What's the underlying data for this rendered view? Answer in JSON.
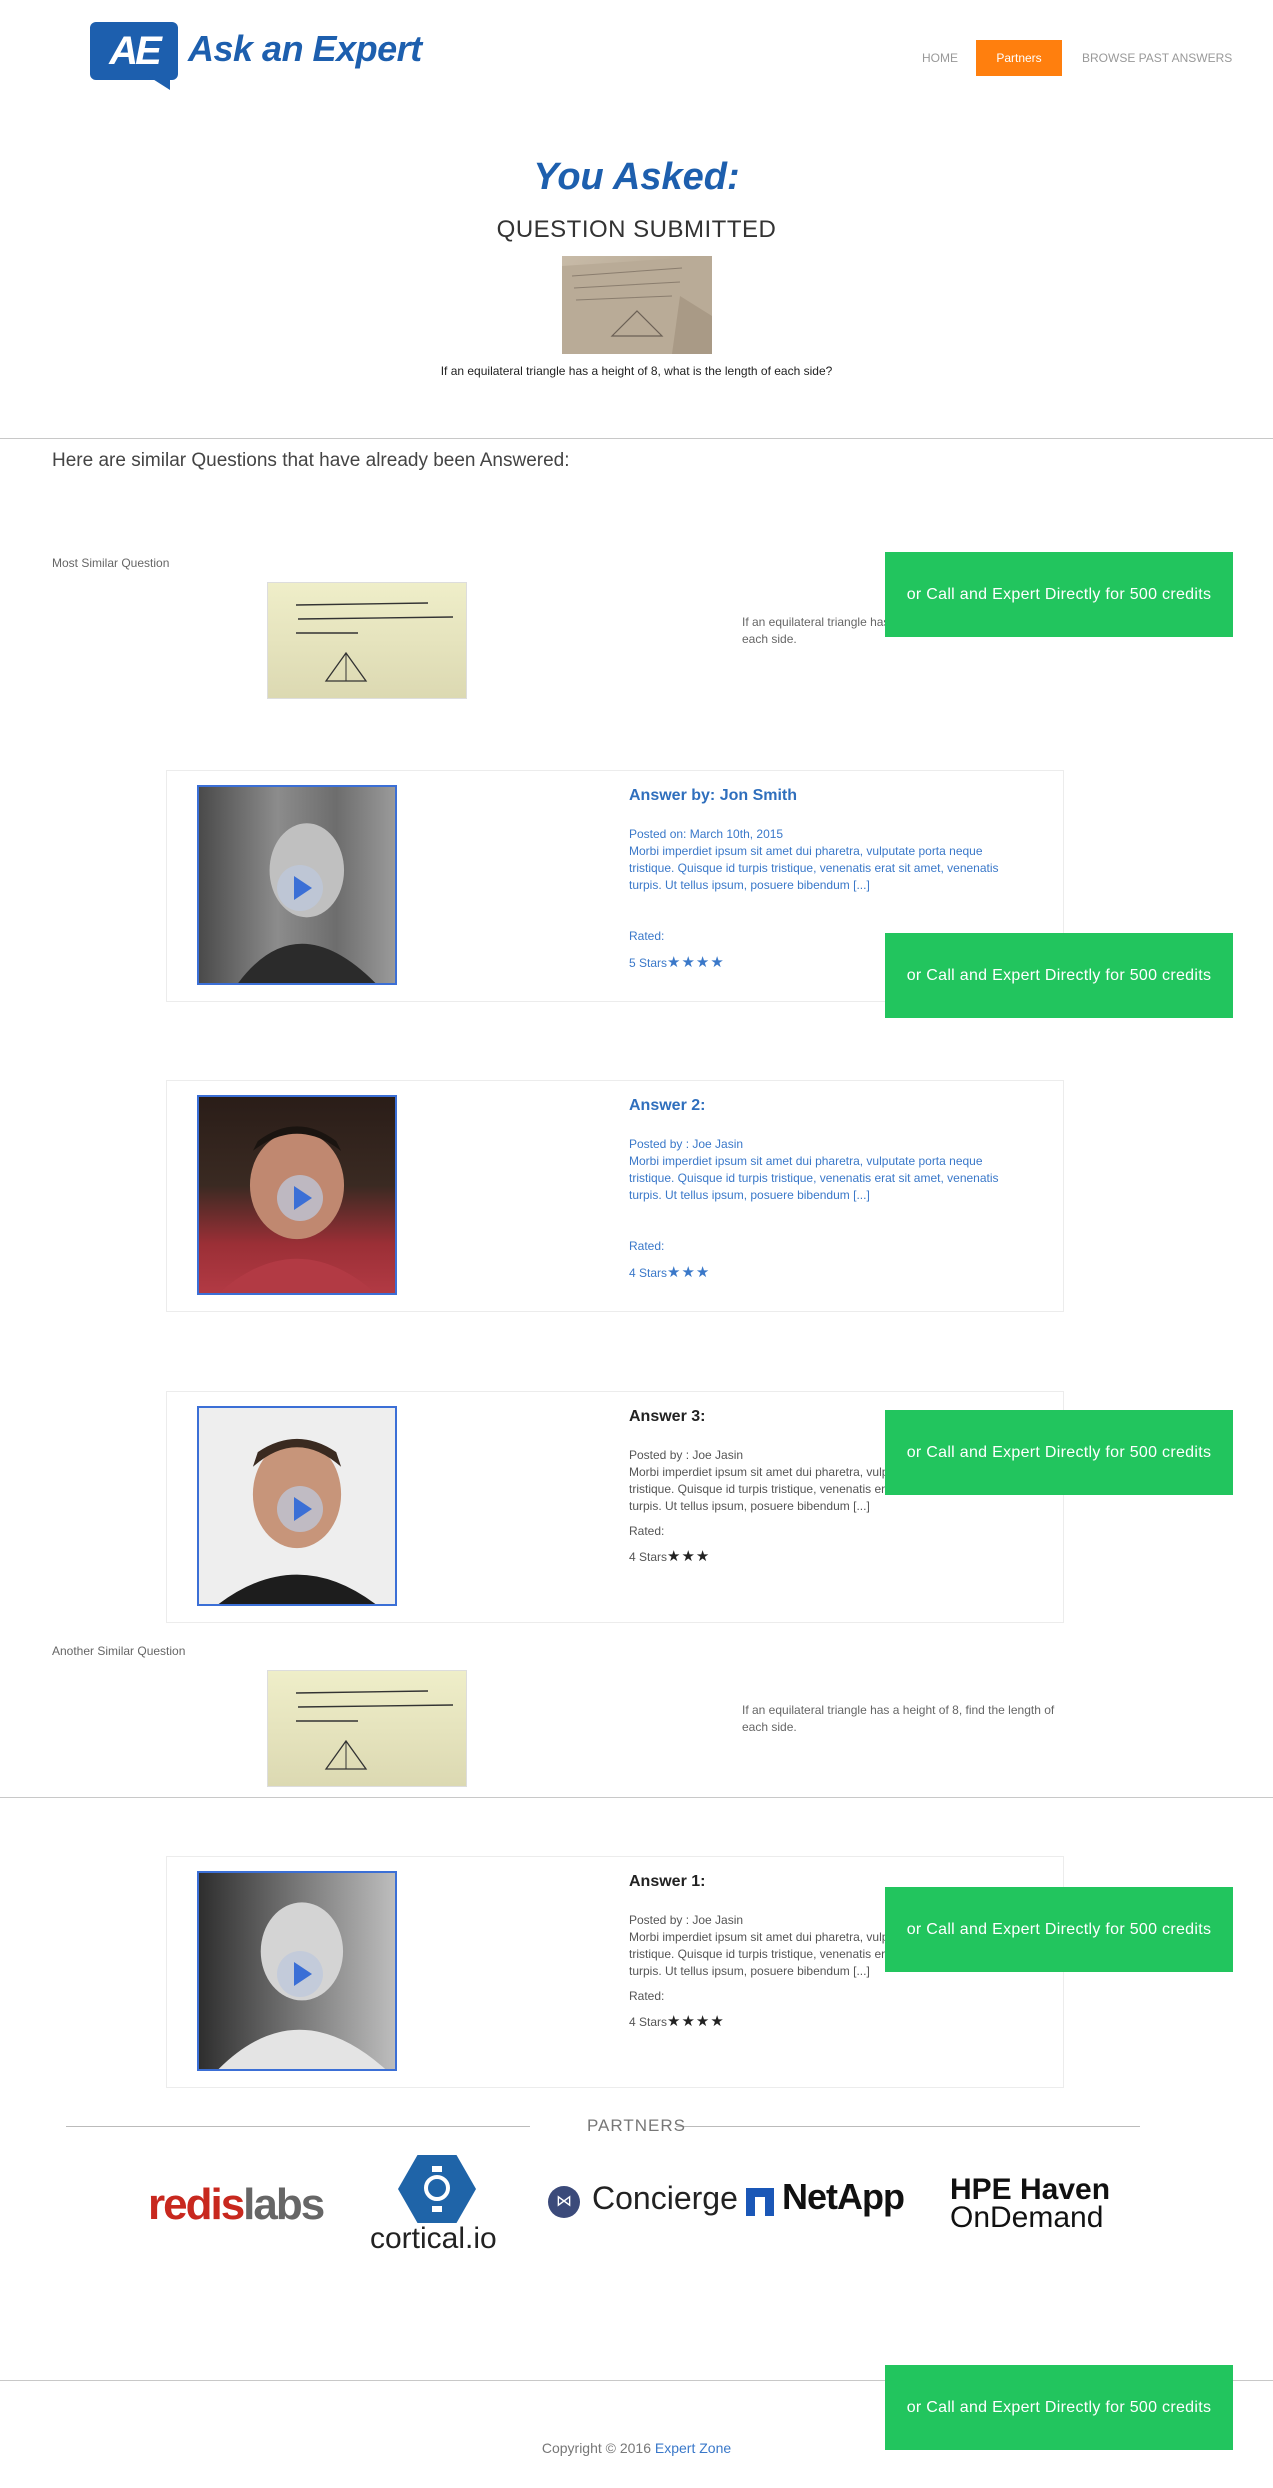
{
  "header": {
    "logo_badge": "AE",
    "logo_text": "Ask an Expert",
    "nav": {
      "home": "HOME",
      "partners": "Partners",
      "browse": "BROWSE PAST ANSWERS"
    }
  },
  "asked": {
    "heading": "You Asked:",
    "status": "QUESTION SUBMITTED",
    "question": "If an equilateral triangle has a height of 8, what is the length of each side?"
  },
  "similar": {
    "heading": "Here are similar Questions that have already been Answered:",
    "most_label": "Most Similar Question",
    "most_text": "If an equilateral triangle has a height of 8, find the length of each side.",
    "another_label": "Another Similar Question",
    "another_text": "If an equilateral triangle has a height of 8, find the length of each side."
  },
  "cta_label": "or Call and Expert Directly for 500 credits",
  "answers": [
    {
      "title": "Answer by: Jon Smith",
      "posted": "Posted on: March 10th, 2015",
      "body": "Morbi imperdiet ipsum sit amet dui pharetra, vulputate porta neque tristique. Quisque id turpis tristique, venenatis erat sit amet, venenatis turpis. Ut tellus ipsum, posuere bibendum [...]",
      "rated_label": "Rated:",
      "stars_text": "5 Stars",
      "stars": "★★★★"
    },
    {
      "title": "Answer 2:",
      "posted": "Posted by : Joe Jasin",
      "body": "Morbi imperdiet ipsum sit amet dui pharetra, vulputate porta neque tristique. Quisque id turpis tristique, venenatis erat sit amet, venenatis turpis. Ut tellus ipsum, posuere bibendum [...]",
      "rated_label": "Rated:",
      "stars_text": "4 Stars",
      "stars": "★★★"
    },
    {
      "title": "Answer 3:",
      "posted": "Posted by : Joe Jasin",
      "body": "Morbi imperdiet ipsum sit amet dui pharetra, vulputate porta neque tristique. Quisque id turpis tristique, venenatis erat sit amet, venenatis turpis. Ut tellus ipsum, posuere bibendum [...]",
      "rated_label": "Rated:",
      "stars_text": "4 Stars",
      "stars": "★★★"
    },
    {
      "title": "Answer 1:",
      "posted": "Posted by : Joe Jasin",
      "body": "Morbi imperdiet ipsum sit amet dui pharetra, vulputate porta neque tristique. Quisque id turpis tristique, venenatis erat sit amet, venenatis turpis. Ut tellus ipsum, posuere bibendum [...]",
      "rated_label": "Rated:",
      "stars_text": "4 Stars",
      "stars": "★★★★"
    }
  ],
  "partners": {
    "title": "PARTNERS",
    "redis_a": "redis",
    "redis_b": "labs",
    "cortical": "cortical.io",
    "concierge": "Concierge",
    "netapp": "NetApp",
    "hpe_a": "HPE Haven",
    "hpe_b": "OnDemand"
  },
  "footer": {
    "copy": "Copyright © 2016 ",
    "link": "Expert Zone"
  },
  "colors": {
    "brand": "#1d5fae",
    "accent": "#ff7f0e",
    "cta": "#22c55e"
  }
}
